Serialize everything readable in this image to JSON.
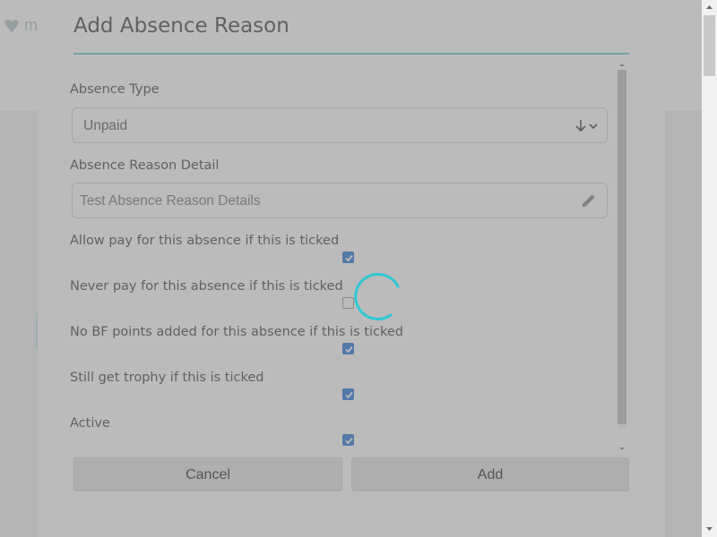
{
  "background": {
    "logo_text": "mo"
  },
  "modal": {
    "title": "Add Absence Reason",
    "fields": {
      "absence_type": {
        "label": "Absence Type",
        "value": "Unpaid"
      },
      "absence_reason_detail": {
        "label": "Absence Reason Detail",
        "value": "Test Absence Reason Details"
      }
    },
    "checkboxes": [
      {
        "label": "Allow pay for this absence if this is ticked",
        "checked": true
      },
      {
        "label": "Never pay for this absence if this is ticked",
        "checked": false
      },
      {
        "label": "No BF points added for this absence if this is ticked",
        "checked": true
      },
      {
        "label": "Still get trophy if this is ticked",
        "checked": true
      },
      {
        "label": "Active",
        "checked": true
      }
    ],
    "buttons": {
      "cancel": "Cancel",
      "add": "Add"
    }
  },
  "colors": {
    "accent": "#6fcdd6",
    "checkbox": "#2f7ad8",
    "spinner": "#2ec8d2"
  },
  "icons": {
    "select": "sort-arrows-icon",
    "text": "pencil-icon",
    "loading": "loading-spinner-icon"
  }
}
